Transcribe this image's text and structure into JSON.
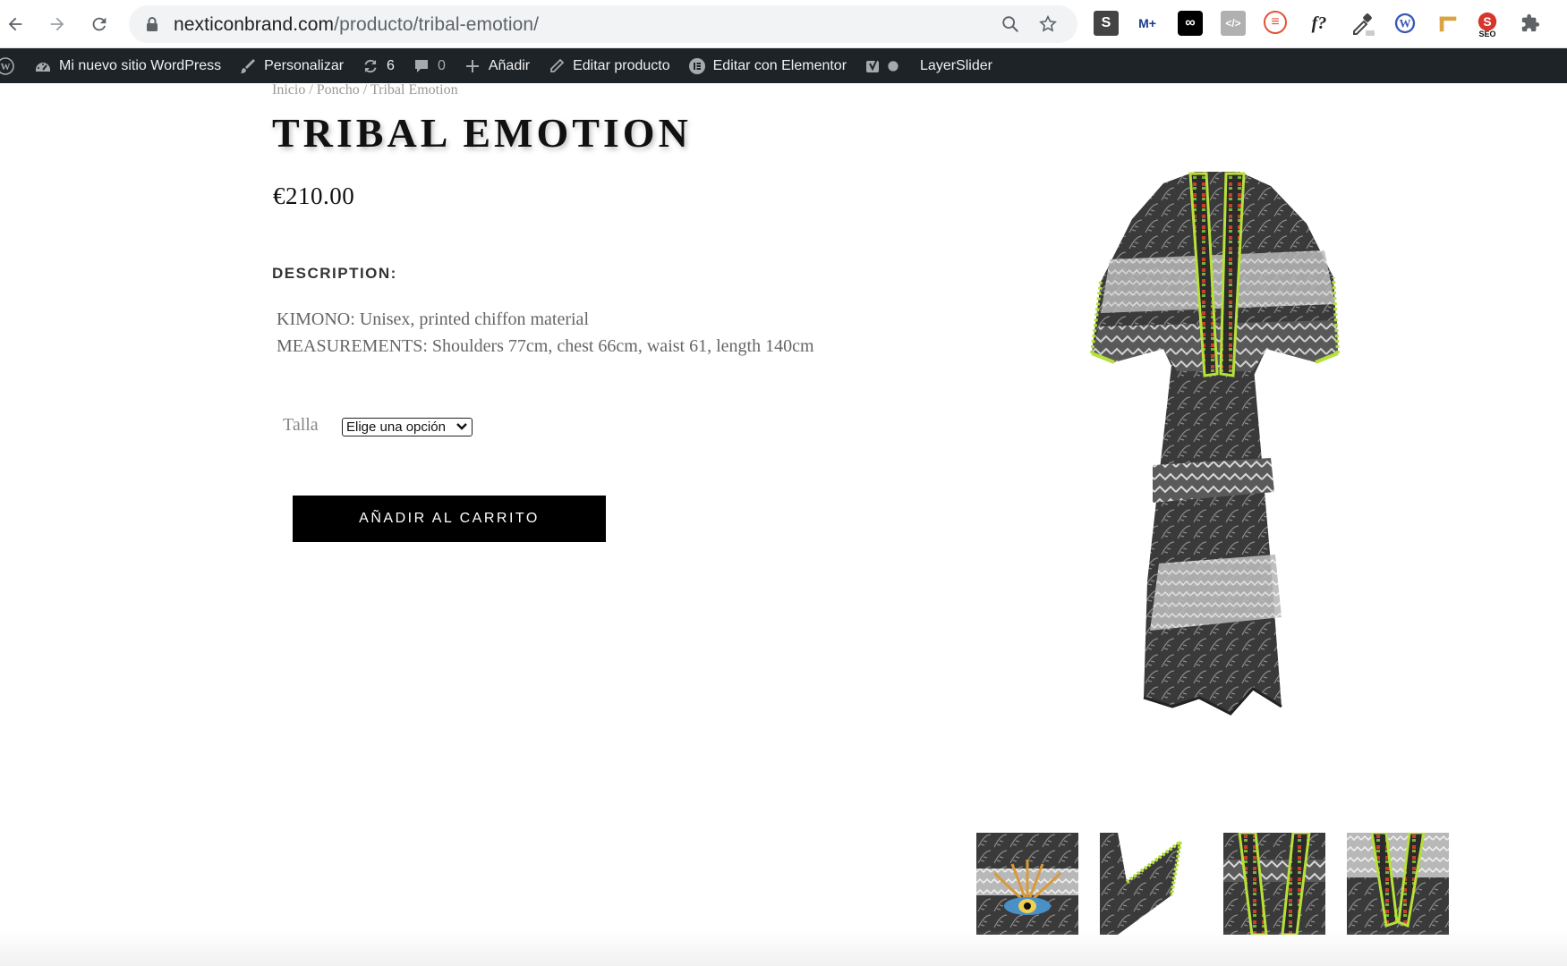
{
  "browser": {
    "url_host": "nexticonbrand.com",
    "url_path": "/producto/tribal-emotion/",
    "extensions": [
      "S",
      "M+",
      "∞",
      "</>",
      "≡",
      "f?",
      "SEO"
    ]
  },
  "adminbar": {
    "site_name": "Mi nuevo sitio WordPress",
    "customize": "Personalizar",
    "updates_count": "6",
    "comments_count": "0",
    "add_new": "Añadir",
    "edit_product": "Editar producto",
    "edit_elementor": "Editar con Elementor",
    "layerslider": "LayerSlider"
  },
  "product": {
    "breadcrumb": "Inicio / Poncho / Tribal Emotion",
    "title": "TRIBAL EMOTION",
    "price": "€210.00",
    "description_heading": "DESCRIPTION:",
    "description_lines": [
      "KIMONO: Unisex, printed chiffon material",
      "MEASUREMENTS: Shoulders 77cm, chest 66cm, waist 61, length 140cm"
    ],
    "size_label": "Talla",
    "size_select_value": "Elige una opción",
    "add_to_cart": "AÑADIR AL CARRITO"
  },
  "colors": {
    "adminbar_bg": "#1d2327",
    "button_bg": "#000000",
    "trim_green": "#b6e03a"
  }
}
